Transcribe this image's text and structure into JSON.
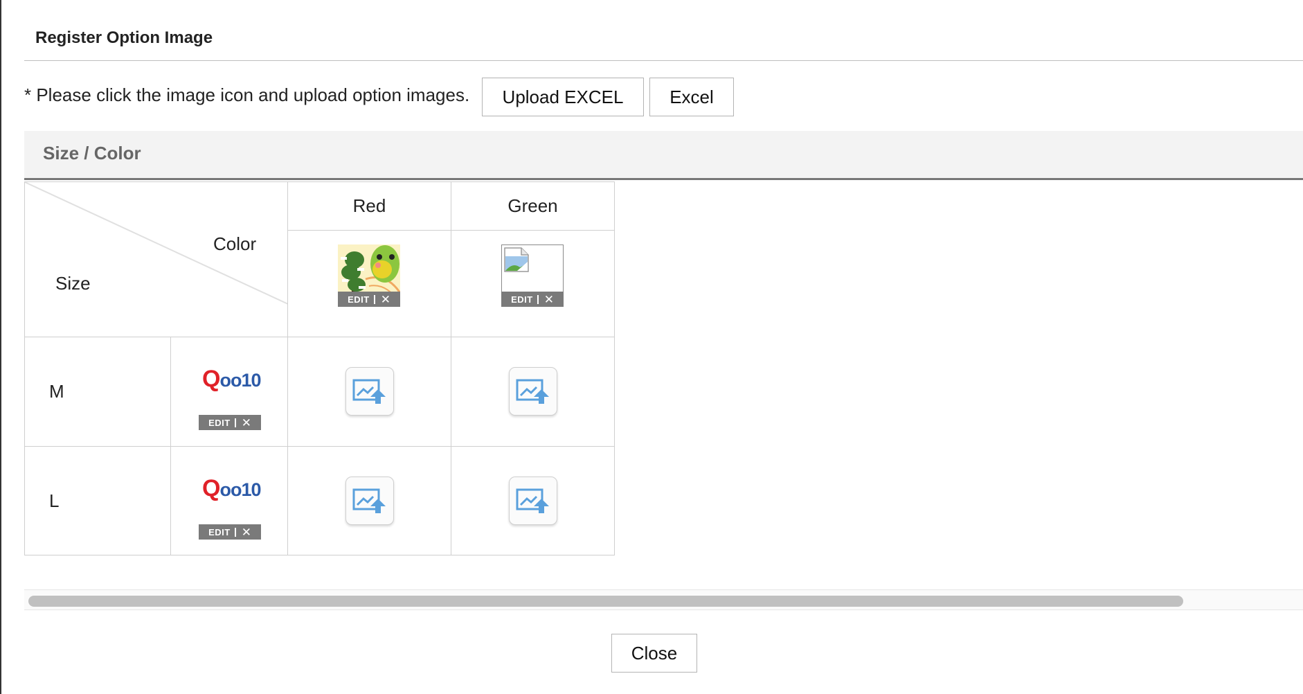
{
  "dialog": {
    "title": "Register Option Image",
    "notice": "* Please click the image icon and upload option images.",
    "upload_excel_label": "Upload EXCEL",
    "excel_label": "Excel",
    "section_label": "Size / Color",
    "close_label": "Close"
  },
  "table": {
    "corner_color_label": "Color",
    "corner_size_label": "Size",
    "edit_label": "EDIT",
    "colors": [
      {
        "name": "Red",
        "image": "character-image"
      },
      {
        "name": "Green",
        "image": "broken-image"
      }
    ],
    "sizes": [
      {
        "name": "M",
        "logo": {
          "q": "Q",
          "rest": "oo10"
        }
      },
      {
        "name": "L",
        "logo": {
          "q": "Q",
          "rest": "oo10"
        }
      }
    ]
  },
  "icons": {
    "upload": "image-upload-icon",
    "remove": "close-icon"
  },
  "colors": {
    "logo_red": "#e02128",
    "logo_blue": "#2c5aa8",
    "upload_icon_blue": "#5aa0dc"
  }
}
